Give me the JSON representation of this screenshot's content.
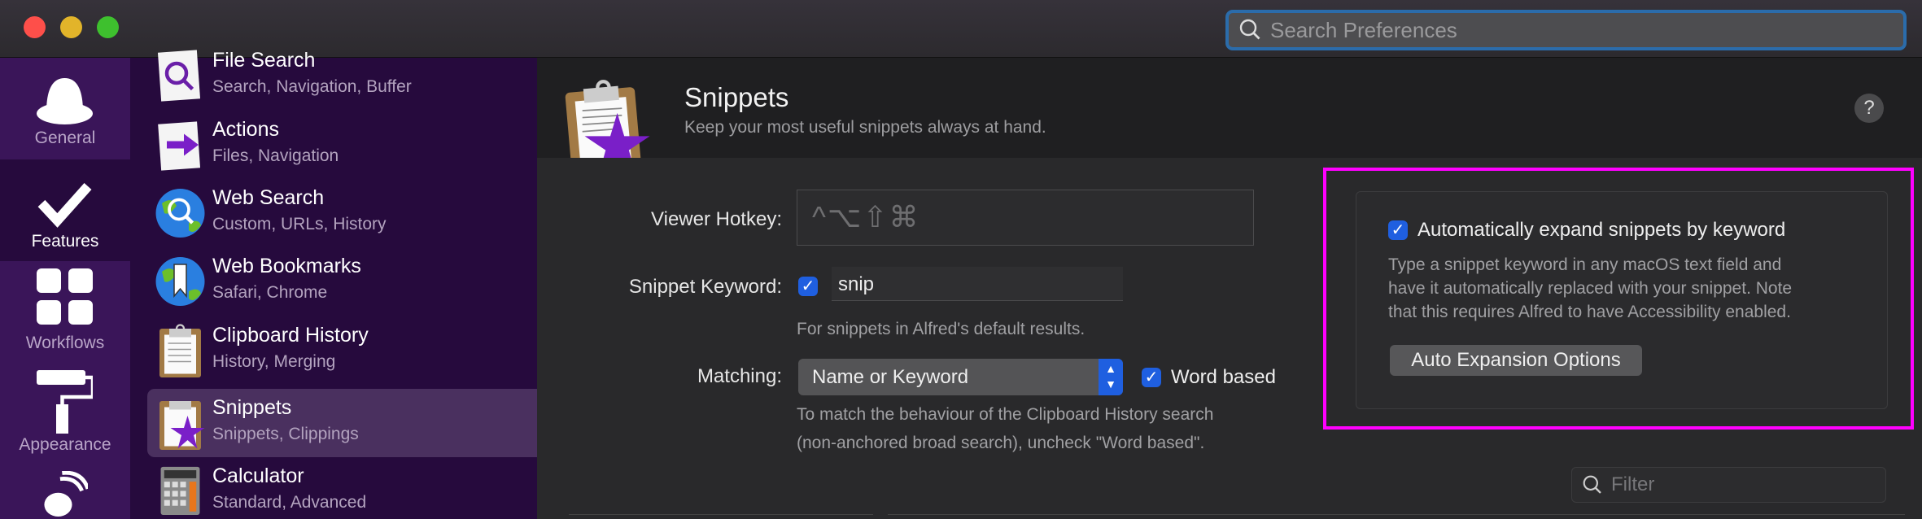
{
  "window": {
    "search_placeholder": "Search Preferences"
  },
  "rail": [
    {
      "label": "General"
    },
    {
      "label": "Features"
    },
    {
      "label": "Workflows"
    },
    {
      "label": "Appearance"
    }
  ],
  "features": [
    {
      "title": "File Search",
      "subtitle": "Search, Navigation, Buffer"
    },
    {
      "title": "Actions",
      "subtitle": "Files, Navigation"
    },
    {
      "title": "Web Search",
      "subtitle": "Custom, URLs, History"
    },
    {
      "title": "Web Bookmarks",
      "subtitle": "Safari, Chrome"
    },
    {
      "title": "Clipboard History",
      "subtitle": "History, Merging"
    },
    {
      "title": "Snippets",
      "subtitle": "Snippets, Clippings"
    },
    {
      "title": "Calculator",
      "subtitle": "Standard, Advanced"
    }
  ],
  "header": {
    "title": "Snippets",
    "subtitle": "Keep your most useful snippets always at hand.",
    "help": "?"
  },
  "form": {
    "viewer_hotkey_label": "Viewer Hotkey:",
    "viewer_hotkey_value": "^⌥⇧⌘",
    "keyword_label": "Snippet Keyword:",
    "keyword_checked": true,
    "keyword_value": "snip",
    "keyword_hint": "For snippets in Alfred's default results.",
    "matching_label": "Matching:",
    "matching_value": "Name or Keyword",
    "word_based_label": "Word based",
    "word_based_checked": true,
    "matching_hint_1": "To match the behaviour of the Clipboard History search",
    "matching_hint_2": "(non-anchored broad search), uncheck \"Word based\"."
  },
  "auto_expand": {
    "checkbox_label": "Automatically expand snippets by keyword",
    "checked": true,
    "desc_1": "Type a snippet keyword in any macOS text field and",
    "desc_2": "have it automatically replaced with your snippet. Note",
    "desc_3": "that this requires Alfred to have Accessibility enabled.",
    "button": "Auto Expansion Options"
  },
  "filter": {
    "placeholder": "Filter"
  },
  "colors": {
    "highlight": "#ff00ff",
    "accent": "#1f5fe0",
    "sidebar": "#3a1559"
  }
}
